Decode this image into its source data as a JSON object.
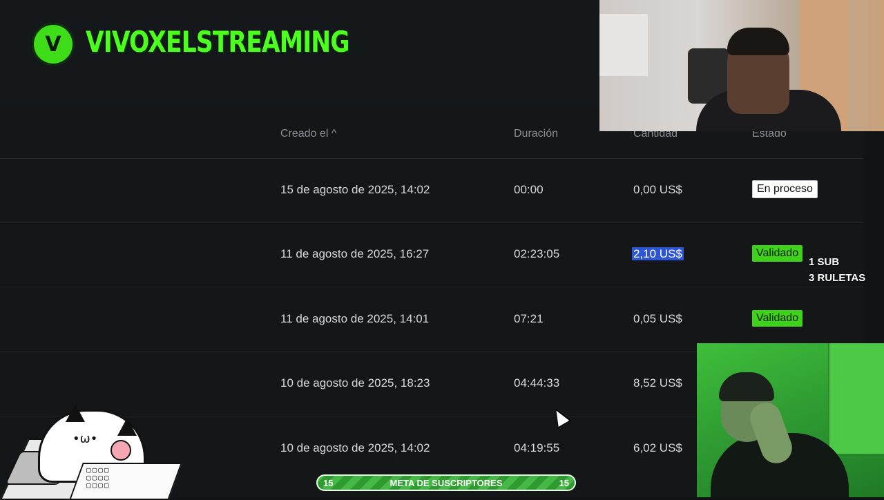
{
  "overlay": {
    "channel_name": "VIVOXELSTREAMING",
    "logo_glyph": "V",
    "sub_note": [
      "1 SUB",
      "3 RULETAS"
    ],
    "goal": {
      "left_count": "15",
      "label": "META DE SUSCRIPTORES",
      "right_count": "15"
    },
    "cat_face": "•ω•",
    "cat_keys": "▢▢▢▢\n▢▢▢▢\n▢▢▢▢"
  },
  "table": {
    "headers": {
      "created": "Creado el ^",
      "duration": "Duración",
      "amount": "Cantidad",
      "status": "Estado"
    },
    "rows": [
      {
        "created": "15 de agosto de 2025, 14:02",
        "duration": "00:00",
        "amount": "0,00 US$",
        "status": "En proceso"
      },
      {
        "created": "11 de agosto de 2025, 16:27",
        "duration": "02:23:05",
        "amount": "2,10 US$",
        "status": "Validado"
      },
      {
        "created": "11 de agosto de 2025, 14:01",
        "duration": "07:21",
        "amount": "0,05 US$",
        "status": "Validado"
      },
      {
        "created": "10 de agosto de 2025, 18:23",
        "duration": "04:44:33",
        "amount": "8,52 US$",
        "status": ""
      },
      {
        "created": "10 de agosto de 2025, 14:02",
        "duration": "04:19:55",
        "amount": "6,02 US$",
        "status": ""
      }
    ]
  },
  "colors": {
    "accent_green": "#4dff1e",
    "validated_badge": "#3fd21a",
    "selection": "#2d56d6",
    "background": "#141618"
  }
}
